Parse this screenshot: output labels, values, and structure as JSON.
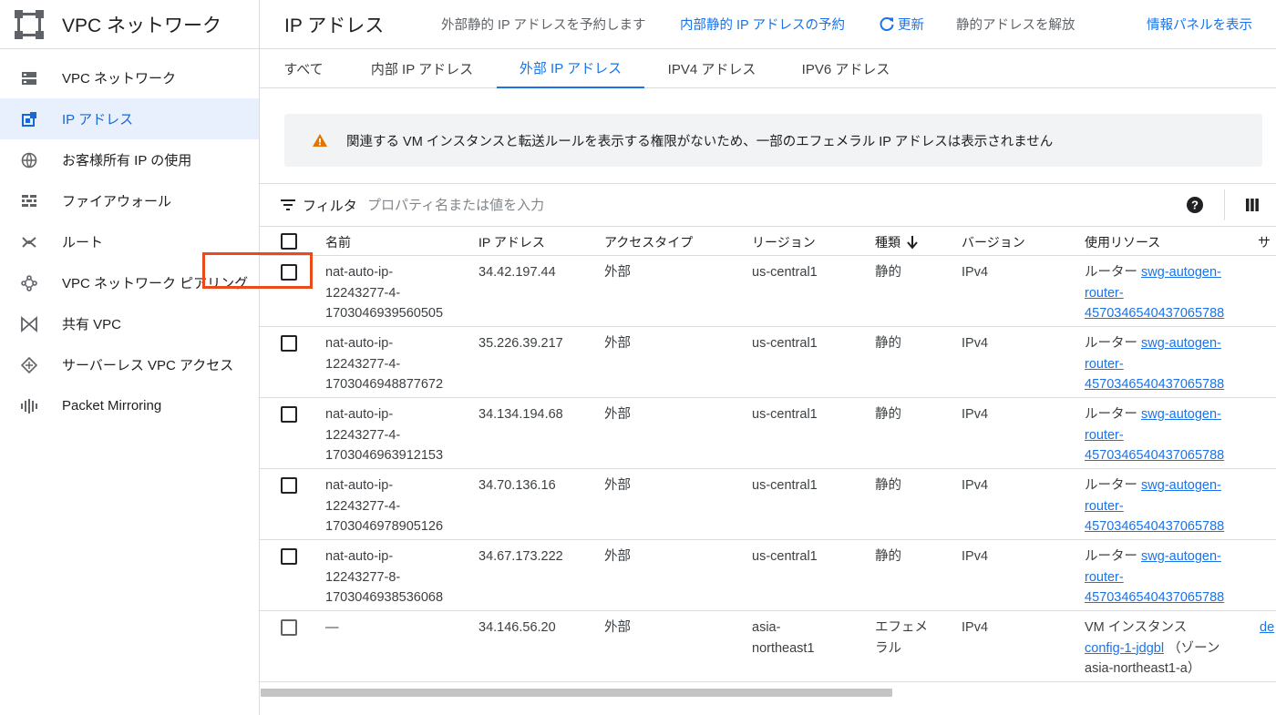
{
  "sidebar": {
    "title": "VPC ネットワーク",
    "items": [
      {
        "label": "VPC ネットワーク",
        "icon": "vpc-network-icon"
      },
      {
        "label": "IP アドレス",
        "icon": "ip-address-icon",
        "active": true
      },
      {
        "label": "お客様所有 IP の使用",
        "icon": "globe-icon"
      },
      {
        "label": "ファイアウォール",
        "icon": "firewall-icon"
      },
      {
        "label": "ルート",
        "icon": "routes-icon"
      },
      {
        "label": "VPC ネットワーク ピアリング",
        "icon": "peering-icon"
      },
      {
        "label": "共有 VPC",
        "icon": "shared-vpc-icon"
      },
      {
        "label": "サーバーレス VPC アクセス",
        "icon": "serverless-icon"
      },
      {
        "label": "Packet Mirroring",
        "icon": "packet-mirroring-icon"
      }
    ]
  },
  "header": {
    "title": "IP アドレス",
    "reserve_external": "外部静的 IP アドレスを予約します",
    "reserve_internal": "内部静的 IP アドレスの予約",
    "refresh": "更新",
    "release": "静的アドレスを解放",
    "info_panel": "情報パネルを表示"
  },
  "tabs": [
    "すべて",
    "内部 IP アドレス",
    "外部 IP アドレス",
    "IPV4 アドレス",
    "IPV6 アドレス"
  ],
  "active_tab": "外部 IP アドレス",
  "notice": "関連する VM インスタンスと転送ルールを表示する権限がないため、一部のエフェメラル IP アドレスは表示されません",
  "filter": {
    "label": "フィルタ",
    "placeholder": "プロパティ名または値を入力"
  },
  "table": {
    "columns": {
      "name": "名前",
      "ip": "IP アドレス",
      "access": "アクセスタイプ",
      "region": "リージョン",
      "type": "種類",
      "version": "バージョン",
      "used_by": "使用リソース",
      "next": "サ"
    },
    "rows": [
      {
        "name": [
          "nat-auto-ip-",
          "12243277-4-",
          "1703046939560505"
        ],
        "ip": "34.42.197.44",
        "access": "外部",
        "region": [
          "us-central1"
        ],
        "type": [
          "静的"
        ],
        "version": "IPv4",
        "res_prefix": "ルーター ",
        "res_link": [
          "swg-autogen-",
          "router-",
          "4570346540437065788"
        ]
      },
      {
        "name": [
          "nat-auto-ip-",
          "12243277-4-",
          "1703046948877672"
        ],
        "ip": "35.226.39.217",
        "access": "外部",
        "region": [
          "us-central1"
        ],
        "type": [
          "静的"
        ],
        "version": "IPv4",
        "res_prefix": "ルーター ",
        "res_link": [
          "swg-autogen-",
          "router-",
          "4570346540437065788"
        ]
      },
      {
        "name": [
          "nat-auto-ip-",
          "12243277-4-",
          "1703046963912153"
        ],
        "ip": "34.134.194.68",
        "access": "外部",
        "region": [
          "us-central1"
        ],
        "type": [
          "静的"
        ],
        "version": "IPv4",
        "res_prefix": "ルーター ",
        "res_link": [
          "swg-autogen-",
          "router-",
          "4570346540437065788"
        ]
      },
      {
        "name": [
          "nat-auto-ip-",
          "12243277-4-",
          "1703046978905126"
        ],
        "ip": "34.70.136.16",
        "access": "外部",
        "region": [
          "us-central1"
        ],
        "type": [
          "静的"
        ],
        "version": "IPv4",
        "res_prefix": "ルーター ",
        "res_link": [
          "swg-autogen-",
          "router-",
          "4570346540437065788"
        ]
      },
      {
        "name": [
          "nat-auto-ip-",
          "12243277-8-",
          "1703046938536068"
        ],
        "ip": "34.67.173.222",
        "access": "外部",
        "region": [
          "us-central1"
        ],
        "type": [
          "静的"
        ],
        "version": "IPv4",
        "res_prefix": "ルーター ",
        "res_link": [
          "swg-autogen-",
          "router-",
          "4570346540437065788"
        ]
      },
      {
        "name": [
          "—"
        ],
        "ip": "34.146.56.20",
        "access": "外部",
        "region": [
          "asia-",
          "northeast1"
        ],
        "type": [
          "エフェメ",
          "ラル"
        ],
        "version": "IPv4",
        "vm_prefix": "VM インスタンス",
        "vm_link": "config-1-jdgbl",
        "vm_suffix": "（ゾーン",
        "vm_zone": "asia-northeast1-a）",
        "extra": "de"
      }
    ]
  },
  "colors": {
    "accent": "#1a73e8",
    "highlight": "#ea4b1c",
    "warning": "#e37400"
  }
}
